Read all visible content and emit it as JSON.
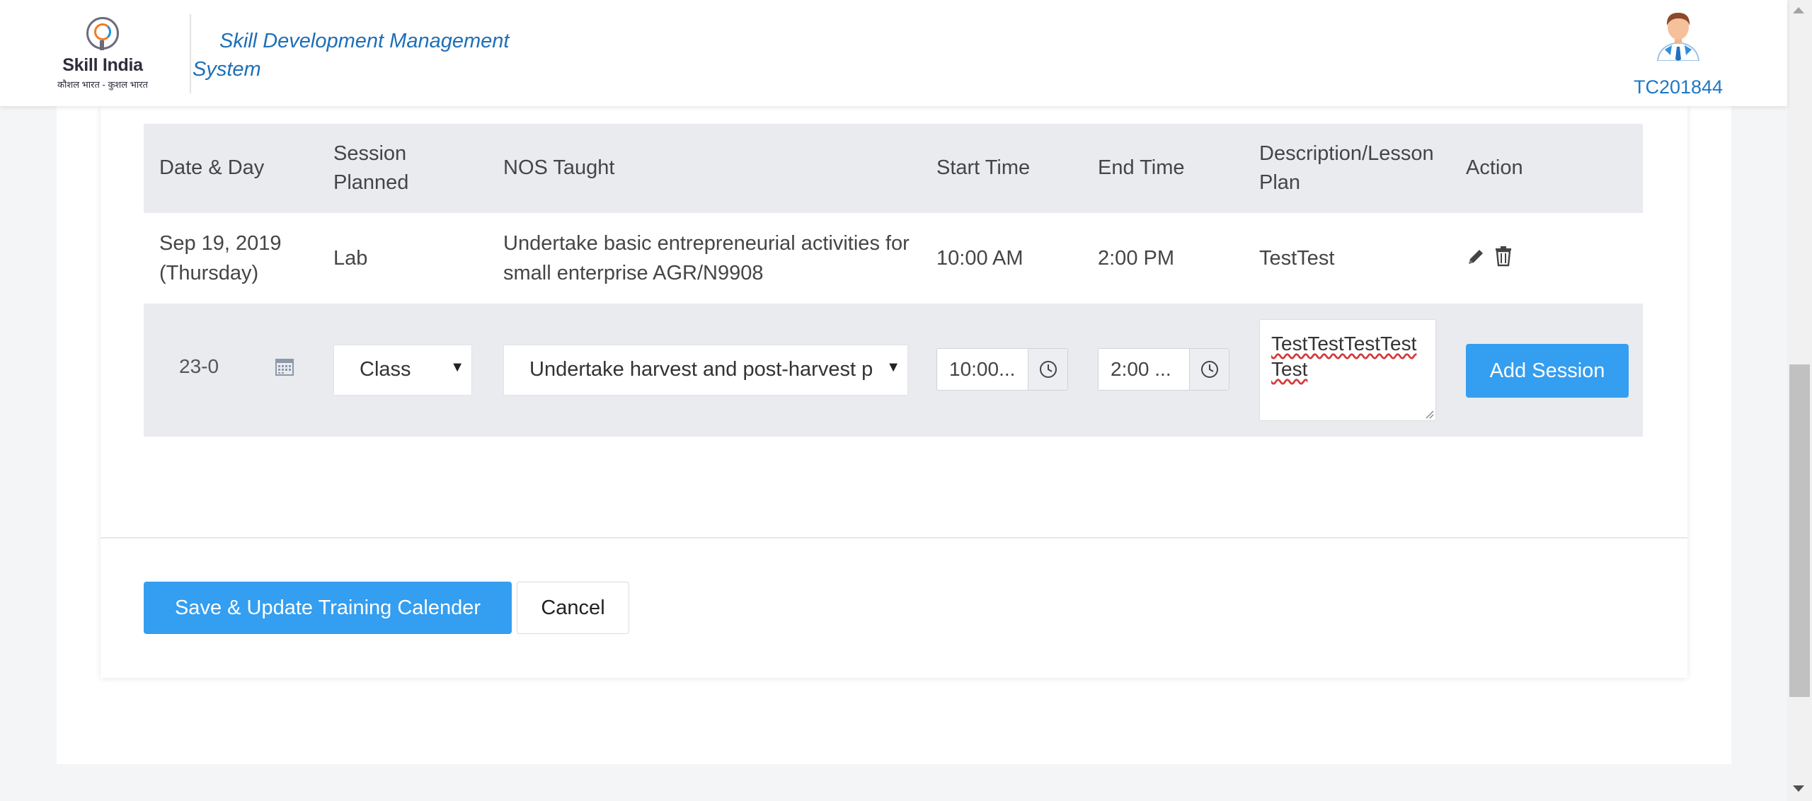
{
  "header": {
    "logo_text": "Skill India",
    "logo_subtext": "कौशल भारत - कुशल भारत",
    "app_title": "Skill Development Management System",
    "user_id": "TC201844"
  },
  "table": {
    "columns": [
      "Date & Day",
      "Session Planned",
      "NOS Taught",
      "Start Time",
      "End Time",
      "Description/Lesson Plan",
      "Action"
    ],
    "rows": [
      {
        "date": "Sep 19, 2019",
        "day": "(Thursday)",
        "session": "Lab",
        "nos": "Undertake basic entrepreneurial activities for small enterprise AGR/N9908",
        "start": "10:00 AM",
        "end": "2:00 PM",
        "description": "TestTest"
      }
    ]
  },
  "new_session": {
    "date_value": "23-0",
    "session_value": "Class",
    "nos_value": "Undertake harvest and post-harvest p",
    "start_value": "10:00...",
    "end_value": "2:00 ...",
    "description_value": "TestTestTestTestTest",
    "add_button": "Add Session"
  },
  "footer": {
    "save_button": "Save & Update Training Calender",
    "cancel_button": "Cancel"
  },
  "colors": {
    "primary": "#349ef0",
    "title_blue": "#1e6fb6",
    "header_row_bg": "#e9ebef"
  }
}
